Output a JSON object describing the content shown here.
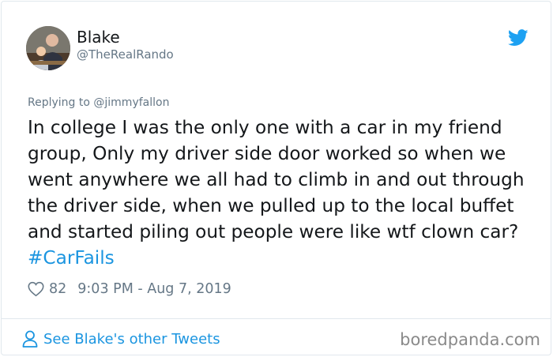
{
  "author": {
    "name": "Blake",
    "handle": "@TheRealRando"
  },
  "reply": {
    "prefix": "Replying to",
    "handle": "@jimmyfallon"
  },
  "tweet": {
    "text": "In college I was the only one with a car in my friend group, Only my driver side door worked so when we went anywhere we all had to climb in and out through the driver side, when we pulled up to the local buffet and started piling out people were like wtf clown car?",
    "hashtag": "#CarFails"
  },
  "meta": {
    "likes": "82",
    "timestamp": "9:03 PM - Aug 7, 2019"
  },
  "footer": {
    "see_more_label": "See Blake's other Tweets",
    "watermark": "boredpanda.com"
  },
  "icons": {
    "brand": "twitter-bird-icon",
    "like": "heart-icon",
    "profile": "person-icon"
  },
  "colors": {
    "link": "#1b95e0",
    "muted": "#657786",
    "text": "#14171a",
    "border": "#e1e8ed"
  }
}
